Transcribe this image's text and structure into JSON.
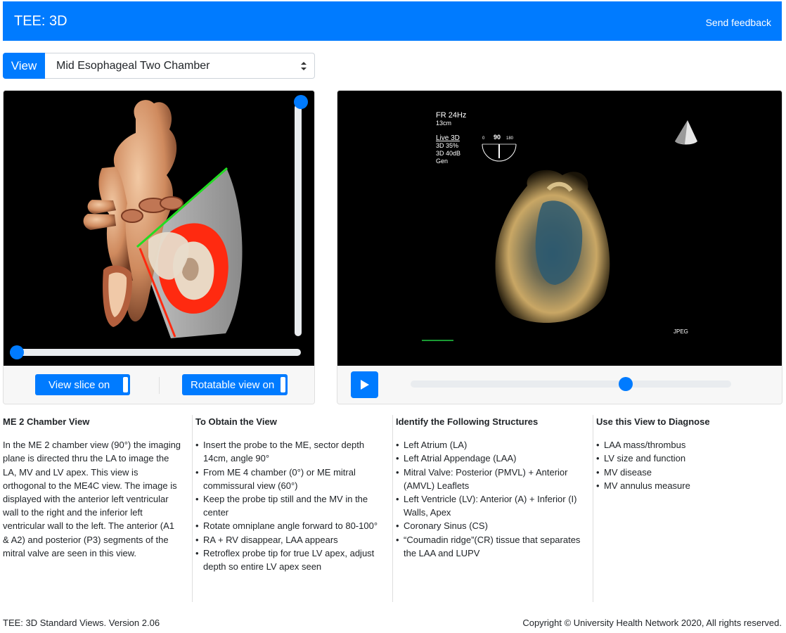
{
  "app": {
    "title": "TEE: 3D",
    "feedback": "Send feedback"
  },
  "view_selector": {
    "label": "View",
    "selected": "Mid Esophageal Two Chamber"
  },
  "left_panel": {
    "toggle_slice": "View slice on",
    "toggle_rotate": "Rotatable view on"
  },
  "video": {
    "frame_rate": "FR 24Hz",
    "depth": "13cm",
    "mode": "Live 3D",
    "gain": "3D 35%",
    "dynamic_range": "3D 40dB",
    "preset": "Gen",
    "angle": "90",
    "angle_min": "0",
    "angle_max": "180",
    "format": "JPEG",
    "progress": 0.68
  },
  "sections": {
    "description": {
      "title": "ME 2 Chamber View",
      "text": "In the ME 2 chamber view (90°) the imaging plane is directed thru the LA to image the LA, MV and LV apex. This view is orthogonal to the ME4C view. The image is displayed with the anterior left ventricular wall to the right and the inferior left ventricular wall to the left. The anterior (A1 & A2) and posterior (P3) segments of the mitral valve are seen in this view."
    },
    "obtain": {
      "title": "To Obtain the View",
      "items": [
        "Insert the probe to the ME, sector depth 14cm, angle 90°",
        "From ME 4 chamber (0°) or ME mitral commissural view (60°)",
        "Keep the probe tip still and the MV in the center",
        "Rotate omniplane angle forward to 80-100°",
        "RA + RV disappear, LAA appears",
        "Retroflex probe tip for true LV apex, adjust depth so entire LV apex seen"
      ]
    },
    "structures": {
      "title": "Identify the Following Structures",
      "items": [
        "Left Atrium (LA)",
        "Left Atrial Appendage (LAA)",
        "Mitral Valve: Posterior (PMVL) + Anterior (AMVL) Leaflets",
        "Left Ventricle (LV): Anterior (A) + Inferior (I) Walls, Apex",
        "Coronary Sinus (CS)",
        "“Coumadin ridge”(CR) tissue that separates the LAA and LUPV"
      ]
    },
    "diagnose": {
      "title": "Use this View to Diagnose",
      "items": [
        "LAA mass/thrombus",
        "LV size and function",
        "MV disease",
        "MV annulus measure"
      ]
    }
  },
  "footer": {
    "left": "TEE: 3D Standard Views. Version 2.06",
    "right": "Copyright © University Health Network 2020, All rights reserved."
  },
  "colors": {
    "primary": "#007bff",
    "stage": "#000000",
    "slice_red": "#ff2a10",
    "plane_green": "#22dd22"
  }
}
